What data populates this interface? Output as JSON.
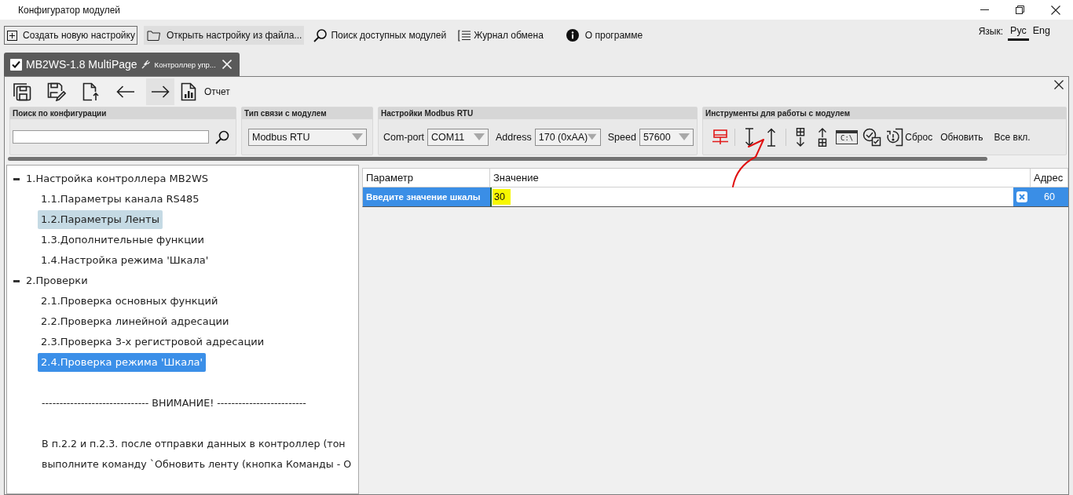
{
  "window": {
    "title": "Конфигуратор модулей"
  },
  "menu": {
    "items": [
      {
        "kind": "new",
        "label": "Создать новую настройку",
        "focused": true,
        "hovered": false
      },
      {
        "kind": "open",
        "label": "Открыть настройку из файла...",
        "focused": false,
        "hovered": true
      },
      {
        "kind": "search",
        "label": "Поиск доступных модулей",
        "focused": false,
        "hovered": false
      },
      {
        "kind": "log",
        "label": "Журнал обмена",
        "focused": false,
        "hovered": false
      },
      {
        "kind": "about",
        "label": "О программе",
        "focused": false,
        "hovered": false
      }
    ],
    "language": {
      "label": "Язык:",
      "options": [
        {
          "label": "Рус",
          "selected": true
        },
        {
          "label": "Eng",
          "selected": false
        }
      ]
    }
  },
  "tabs": [
    {
      "title": "MB2WS-1.8 MultiPage",
      "subtitle": "Контроллер упр...",
      "checked": true,
      "selected": true
    }
  ],
  "toolbar": {
    "buttons": [
      {
        "kind": "save-all",
        "hovered": false
      },
      {
        "kind": "save-as",
        "hovered": false
      },
      {
        "kind": "export",
        "hovered": false
      },
      {
        "kind": "back",
        "hovered": false
      },
      {
        "kind": "forward",
        "hovered": true
      },
      {
        "kind": "report",
        "label": "Отчет",
        "hovered": false
      }
    ]
  },
  "groups": [
    {
      "kind": "search",
      "title": "Поиск по конфигурации"
    },
    {
      "kind": "connection",
      "title": "Тип связи с модулем",
      "select": "Modbus RTU"
    },
    {
      "kind": "modbus",
      "title": "Настройки Modbus RTU",
      "fields": [
        {
          "label": "Com-port",
          "value": "COM11"
        },
        {
          "label": "Address",
          "value": "170 (0xAA)"
        },
        {
          "label": "Speed",
          "value": "57600"
        }
      ]
    },
    {
      "kind": "tools",
      "title": "Инструменты для работы с модулем",
      "tools": [
        {
          "kind": "connection",
          "connected": false
        },
        {
          "kind": "separator"
        },
        {
          "kind": "read"
        },
        {
          "kind": "write"
        },
        {
          "kind": "separator"
        },
        {
          "kind": "read-table"
        },
        {
          "kind": "write-table"
        },
        {
          "kind": "console",
          "label": "C:\\"
        },
        {
          "kind": "verify"
        },
        {
          "kind": "reset",
          "label": "Сброс"
        },
        {
          "kind": "refresh",
          "label": "Обновить"
        },
        {
          "kind": "enable-all",
          "label": "Все вкл."
        }
      ]
    }
  ],
  "tree": {
    "nodes": [
      {
        "label": "1.Настройка контроллера MB2WS",
        "expanded": true,
        "selected": false,
        "highlighted": false,
        "children": [
          {
            "label": "1.1.Параметры канала RS485",
            "selected": false,
            "highlighted": false
          },
          {
            "label": "1.2.Параметры Ленты",
            "selected": false,
            "highlighted": true
          },
          {
            "label": "1.3.Дополнительные функции",
            "selected": false,
            "highlighted": false
          },
          {
            "label": "1.4.Настройка режима 'Шкала'",
            "selected": false,
            "highlighted": false
          }
        ]
      },
      {
        "label": "2.Проверки",
        "expanded": true,
        "selected": false,
        "highlighted": false,
        "children": [
          {
            "label": "2.1.Проверка основных функций",
            "selected": false,
            "highlighted": false
          },
          {
            "label": "2.2.Проверка линейной адресации",
            "selected": false,
            "highlighted": false
          },
          {
            "label": "2.3.Проверка 3-х регистровой адресации",
            "selected": false,
            "highlighted": false
          },
          {
            "label": "2.4.Проверка режима 'Шкала'",
            "selected": true,
            "highlighted": false
          }
        ]
      }
    ],
    "notes": [
      [
        "------------------------------ ВНИМАНИЕ! -------------------------"
      ],
      [
        "В п.2.2 и п.2.3. после отправки данных в контроллер (тон",
        "выполните команду `Обновить ленту (кнопка Команды - О"
      ]
    ]
  },
  "table": {
    "columns": [
      "Параметр",
      "Значение",
      "Адрес"
    ],
    "rows": [
      {
        "parameter": "Введите значение шкалы",
        "value": "30",
        "address": "60",
        "selected": true,
        "value_highlighted": true
      }
    ]
  }
}
